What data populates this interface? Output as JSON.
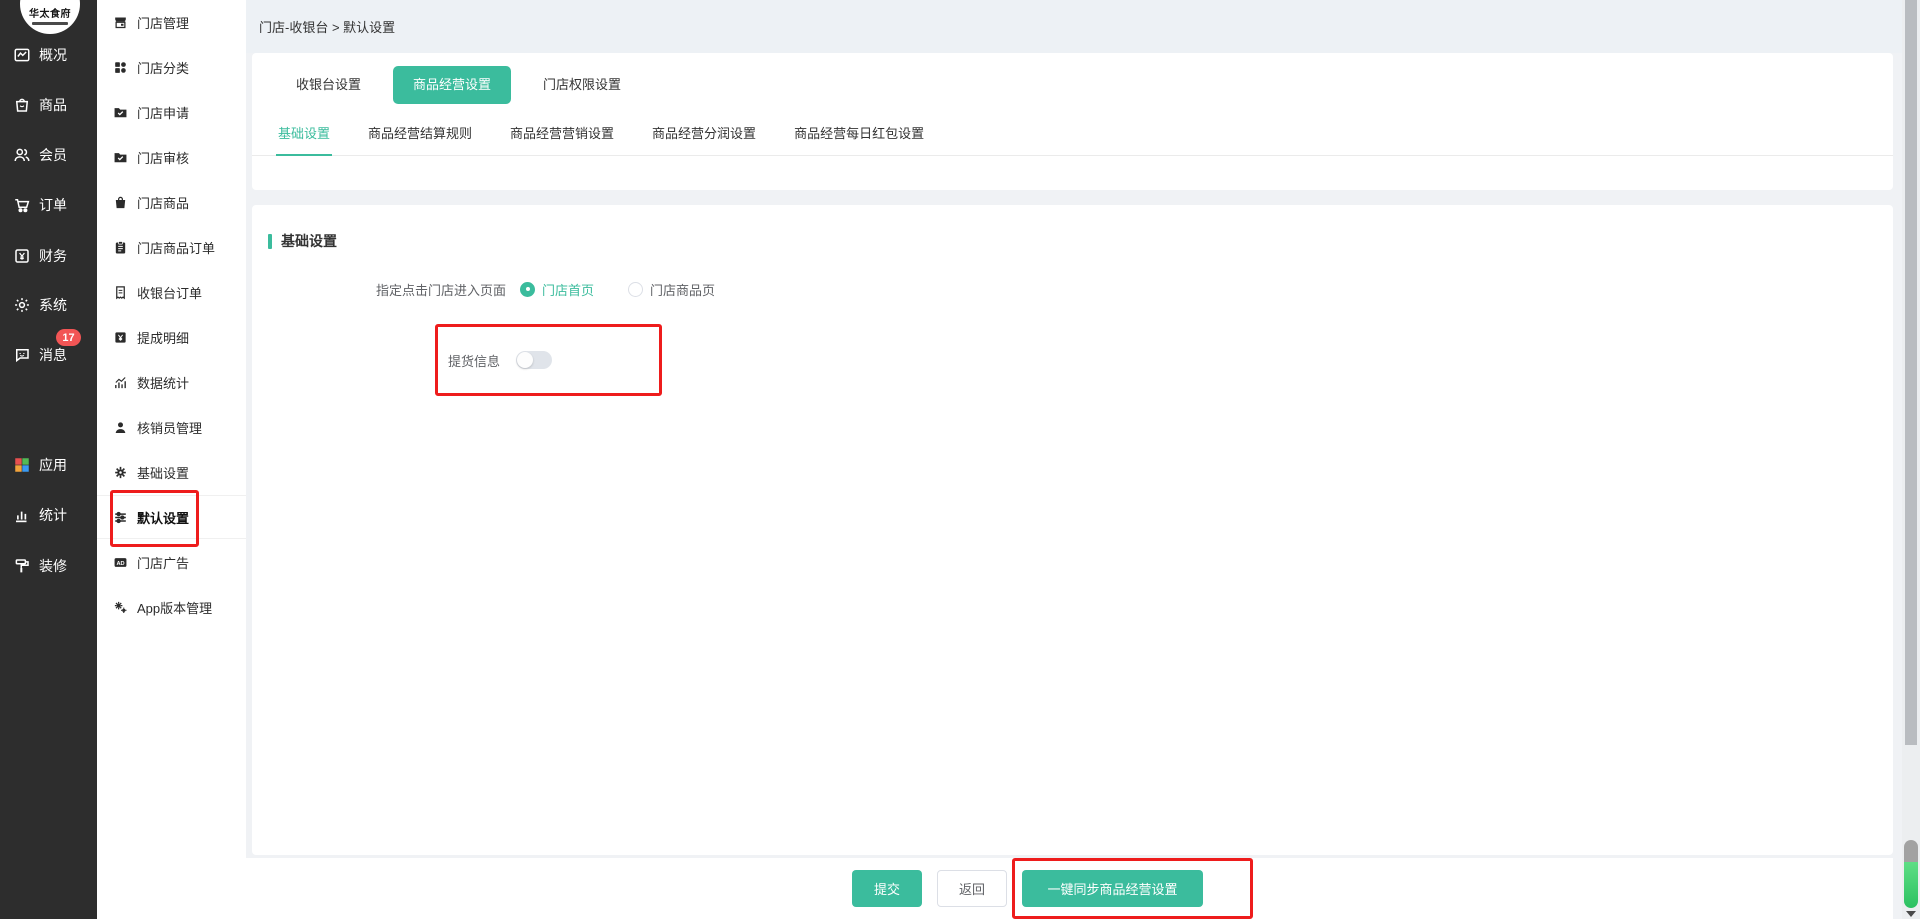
{
  "brand": {
    "name": "华太食府"
  },
  "colors": {
    "accent": "#3bbc9d",
    "annotation": "#ee1c1c",
    "badge": "#f25555",
    "sidebar_bg": "#2d2d2d"
  },
  "primary_sidebar": {
    "items": [
      {
        "label": "概况",
        "icon": "overview"
      },
      {
        "label": "商品",
        "icon": "goods"
      },
      {
        "label": "会员",
        "icon": "member"
      },
      {
        "label": "订单",
        "icon": "order"
      },
      {
        "label": "财务",
        "icon": "finance"
      },
      {
        "label": "系统",
        "icon": "system"
      },
      {
        "label": "消息",
        "icon": "message",
        "badge": "17"
      },
      {
        "label": "应用",
        "icon": "apps"
      },
      {
        "label": "统计",
        "icon": "stats"
      },
      {
        "label": "装修",
        "icon": "decorate"
      }
    ]
  },
  "secondary_sidebar": {
    "items": [
      {
        "label": "门店管理",
        "icon": "store"
      },
      {
        "label": "门店分类",
        "icon": "category"
      },
      {
        "label": "门店申请",
        "icon": "folder-check"
      },
      {
        "label": "门店审核",
        "icon": "folder-check2"
      },
      {
        "label": "门店商品",
        "icon": "bag"
      },
      {
        "label": "门店商品订单",
        "icon": "clipboard"
      },
      {
        "label": "收银台订单",
        "icon": "receipt"
      },
      {
        "label": "提成明细",
        "icon": "commission"
      },
      {
        "label": "数据统计",
        "icon": "chart"
      },
      {
        "label": "核销员管理",
        "icon": "person"
      },
      {
        "label": "基础设置",
        "icon": "gear"
      },
      {
        "label": "默认设置",
        "icon": "sliders",
        "selected": true,
        "annotated": true
      },
      {
        "label": "门店广告",
        "icon": "ad"
      },
      {
        "label": "App版本管理",
        "icon": "gears"
      }
    ]
  },
  "breadcrumb": {
    "text": "门店-收银台 > 默认设置"
  },
  "tabs": {
    "items": [
      {
        "label": "收银台设置"
      },
      {
        "label": "商品经营设置",
        "active": true
      },
      {
        "label": "门店权限设置"
      }
    ]
  },
  "subtabs": {
    "items": [
      {
        "label": "基础设置",
        "active": true
      },
      {
        "label": "商品经营结算规则"
      },
      {
        "label": "商品经营营销设置"
      },
      {
        "label": "商品经营分润设置"
      },
      {
        "label": "商品经营每日红包设置"
      }
    ]
  },
  "section": {
    "title": "基础设置"
  },
  "form": {
    "entry_page": {
      "label": "指定点击门店进入页面",
      "options": [
        {
          "label": "门店首页",
          "selected": true
        },
        {
          "label": "门店商品页",
          "selected": false
        }
      ]
    },
    "pickup": {
      "label": "提货信息",
      "enabled": false
    }
  },
  "footer": {
    "submit": "提交",
    "back": "返回",
    "sync": "一键同步商品经营设置"
  }
}
